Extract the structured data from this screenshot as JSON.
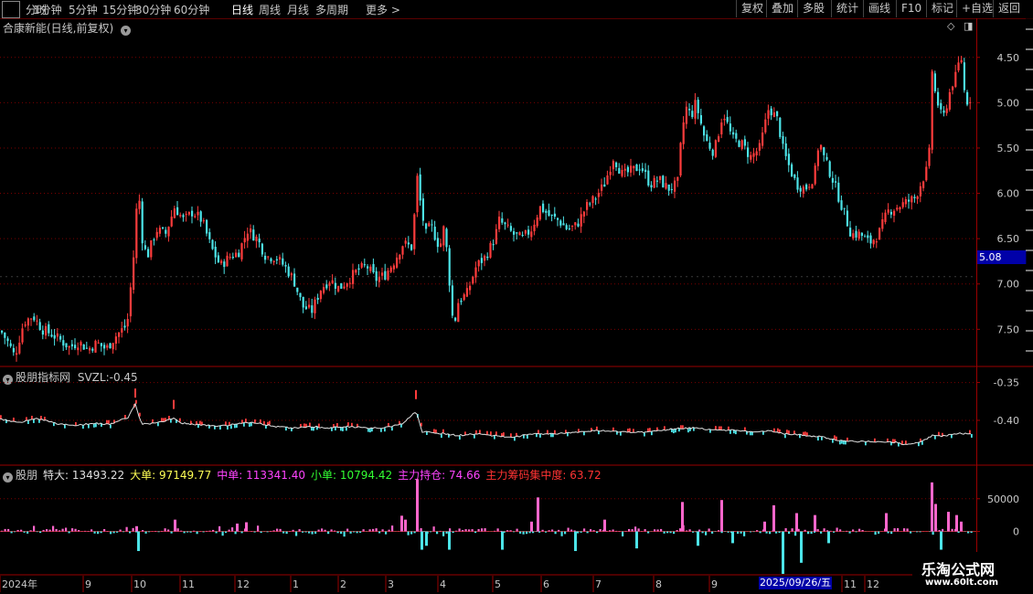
{
  "toolbar": {
    "timeframes": [
      "分时",
      "1分钟",
      "5分钟",
      "15分钟",
      "30分钟",
      "60分钟",
      "日线",
      "周线",
      "月线",
      "多周期",
      "更多 >"
    ],
    "active": "日线",
    "buttons": [
      "复权",
      "叠加",
      "多股",
      "统计",
      "画线",
      "F10",
      "标记",
      "+自选",
      "返回"
    ]
  },
  "main": {
    "title": "合康新能(日线,前复权)",
    "price_tag": "5.08",
    "right_labels": [
      "7.50",
      "7.00",
      "6.50",
      "6.00",
      "5.50",
      "5.00",
      "4.50"
    ]
  },
  "indicator1": {
    "title": "股朋指标网",
    "name": "SVZL:",
    "value": "-0.45",
    "right_labels": [
      "-0.35",
      "-0.40"
    ]
  },
  "indicator2": {
    "title": "股朋",
    "items": [
      {
        "label": "特大:",
        "value": "13493.22",
        "color": "#e0e0e0"
      },
      {
        "label": "大单:",
        "value": "97149.77",
        "color": "#ffff55"
      },
      {
        "label": "中单:",
        "value": "113341.40",
        "color": "#ff44ff"
      },
      {
        "label": "小单:",
        "value": "10794.42",
        "color": "#33ff33"
      },
      {
        "label": "主力持仓:",
        "value": "74.66",
        "color": "#ff44ff"
      },
      {
        "label": "主力筹码集中度:",
        "value": "63.72",
        "color": "#ff3333"
      }
    ],
    "right_labels": [
      "50000",
      "0"
    ]
  },
  "xaxis": {
    "labels": [
      "2024年",
      "9",
      "10",
      "11",
      "12",
      "1",
      "2",
      "3",
      "4",
      "5",
      "6",
      "7",
      "8",
      "9",
      "10",
      "11",
      "12"
    ],
    "highlight": "2025/09/26/五"
  },
  "watermark": {
    "line1": "乐淘公式网",
    "line2": "www.60lt.com"
  },
  "colors": {
    "up": "#ff3c3c",
    "down": "#4ce4e8",
    "grid": "#7a0000",
    "pink": "#ff66cc"
  },
  "chart_data": [
    {
      "type": "candlestick",
      "title": "合康新能(日线,前复权)",
      "ylim": [
        4.1,
        7.75
      ],
      "y_ticks": [
        4.5,
        5.0,
        5.5,
        6.0,
        6.5,
        7.0,
        7.5
      ],
      "current_price": 5.08,
      "close_path": [
        [
          0,
          4.48
        ],
        [
          8,
          4.35
        ],
        [
          15,
          4.2
        ],
        [
          25,
          4.58
        ],
        [
          35,
          4.65
        ],
        [
          45,
          4.5
        ],
        [
          55,
          4.45
        ],
        [
          65,
          4.38
        ],
        [
          75,
          4.3
        ],
        [
          85,
          4.36
        ],
        [
          95,
          4.28
        ],
        [
          105,
          4.35
        ],
        [
          115,
          4.28
        ],
        [
          125,
          4.42
        ],
        [
          138,
          4.55
        ],
        [
          145,
          5.3
        ],
        [
          150,
          6.1
        ],
        [
          155,
          5.45
        ],
        [
          160,
          5.3
        ],
        [
          170,
          5.6
        ],
        [
          180,
          5.55
        ],
        [
          190,
          5.85
        ],
        [
          200,
          5.7
        ],
        [
          210,
          5.8
        ],
        [
          220,
          5.7
        ],
        [
          230,
          5.4
        ],
        [
          240,
          5.2
        ],
        [
          250,
          5.3
        ],
        [
          260,
          5.35
        ],
        [
          270,
          5.6
        ],
        [
          280,
          5.5
        ],
        [
          290,
          5.3
        ],
        [
          300,
          5.3
        ],
        [
          310,
          5.2
        ],
        [
          320,
          5.05
        ],
        [
          330,
          4.75
        ],
        [
          340,
          4.7
        ],
        [
          350,
          4.95
        ],
        [
          360,
          5.05
        ],
        [
          370,
          4.95
        ],
        [
          380,
          5.05
        ],
        [
          390,
          5.15
        ],
        [
          400,
          5.2
        ],
        [
          410,
          5.05
        ],
        [
          420,
          5.1
        ],
        [
          430,
          5.25
        ],
        [
          440,
          5.45
        ],
        [
          450,
          5.4
        ],
        [
          455,
          6.2
        ],
        [
          460,
          5.8
        ],
        [
          465,
          5.55
        ],
        [
          470,
          5.65
        ],
        [
          480,
          5.4
        ],
        [
          485,
          5.65
        ],
        [
          490,
          5.1
        ],
        [
          495,
          4.5
        ],
        [
          500,
          4.8
        ],
        [
          510,
          4.9
        ],
        [
          520,
          5.2
        ],
        [
          530,
          5.3
        ],
        [
          540,
          5.5
        ],
        [
          545,
          5.7
        ],
        [
          550,
          5.65
        ],
        [
          560,
          5.55
        ],
        [
          570,
          5.5
        ],
        [
          580,
          5.6
        ],
        [
          590,
          5.85
        ],
        [
          600,
          5.75
        ],
        [
          610,
          5.7
        ],
        [
          620,
          5.6
        ],
        [
          630,
          5.65
        ],
        [
          640,
          5.85
        ],
        [
          650,
          5.95
        ],
        [
          660,
          6.1
        ],
        [
          670,
          6.4
        ],
        [
          680,
          6.2
        ],
        [
          690,
          6.25
        ],
        [
          700,
          6.3
        ],
        [
          710,
          6.1
        ],
        [
          720,
          6.15
        ],
        [
          730,
          6.05
        ],
        [
          740,
          6.1
        ],
        [
          745,
          6.7
        ],
        [
          750,
          6.95
        ],
        [
          755,
          6.85
        ],
        [
          760,
          7.0
        ],
        [
          765,
          6.8
        ],
        [
          770,
          6.6
        ],
        [
          780,
          6.45
        ],
        [
          790,
          6.9
        ],
        [
          800,
          6.6
        ],
        [
          810,
          6.55
        ],
        [
          820,
          6.4
        ],
        [
          830,
          6.5
        ],
        [
          840,
          6.95
        ],
        [
          850,
          6.8
        ],
        [
          855,
          6.5
        ],
        [
          860,
          6.35
        ],
        [
          870,
          6.1
        ],
        [
          880,
          6.05
        ],
        [
          890,
          6.2
        ],
        [
          895,
          6.6
        ],
        [
          900,
          6.4
        ],
        [
          910,
          6.15
        ],
        [
          920,
          5.85
        ],
        [
          930,
          5.55
        ],
        [
          940,
          5.55
        ],
        [
          950,
          5.45
        ],
        [
          960,
          5.55
        ],
        [
          970,
          5.8
        ],
        [
          980,
          5.85
        ],
        [
          990,
          5.9
        ],
        [
          1000,
          5.95
        ],
        [
          1010,
          6.2
        ],
        [
          1015,
          6.3
        ],
        [
          1018,
          7.4
        ],
        [
          1022,
          7.1
        ],
        [
          1030,
          6.8
        ],
        [
          1040,
          7.2
        ],
        [
          1045,
          7.3
        ],
        [
          1050,
          7.55
        ],
        [
          1055,
          7.0
        ],
        [
          1060,
          7.05
        ]
      ]
    },
    {
      "type": "line",
      "title": "股朋指标网",
      "series": [
        {
          "name": "SVZL",
          "last": -0.45
        }
      ],
      "y_ticks": [
        -0.35,
        -0.4
      ],
      "ylim": [
        -0.458,
        -0.33
      ],
      "path": [
        [
          0,
          -0.398
        ],
        [
          20,
          -0.403
        ],
        [
          40,
          -0.397
        ],
        [
          60,
          -0.404
        ],
        [
          80,
          -0.407
        ],
        [
          100,
          -0.404
        ],
        [
          120,
          -0.405
        ],
        [
          140,
          -0.396
        ],
        [
          148,
          -0.379
        ],
        [
          155,
          -0.405
        ],
        [
          170,
          -0.404
        ],
        [
          190,
          -0.398
        ],
        [
          200,
          -0.404
        ],
        [
          220,
          -0.406
        ],
        [
          240,
          -0.408
        ],
        [
          260,
          -0.404
        ],
        [
          280,
          -0.403
        ],
        [
          300,
          -0.408
        ],
        [
          320,
          -0.41
        ],
        [
          340,
          -0.408
        ],
        [
          360,
          -0.41
        ],
        [
          380,
          -0.408
        ],
        [
          400,
          -0.41
        ],
        [
          420,
          -0.41
        ],
        [
          440,
          -0.405
        ],
        [
          455,
          -0.388
        ],
        [
          462,
          -0.415
        ],
        [
          480,
          -0.417
        ],
        [
          500,
          -0.42
        ],
        [
          520,
          -0.418
        ],
        [
          540,
          -0.42
        ],
        [
          560,
          -0.423
        ],
        [
          580,
          -0.418
        ],
        [
          600,
          -0.418
        ],
        [
          620,
          -0.417
        ],
        [
          640,
          -0.414
        ],
        [
          660,
          -0.414
        ],
        [
          680,
          -0.415
        ],
        [
          700,
          -0.416
        ],
        [
          720,
          -0.414
        ],
        [
          740,
          -0.411
        ],
        [
          760,
          -0.41
        ],
        [
          780,
          -0.413
        ],
        [
          800,
          -0.413
        ],
        [
          820,
          -0.415
        ],
        [
          840,
          -0.414
        ],
        [
          860,
          -0.418
        ],
        [
          880,
          -0.42
        ],
        [
          900,
          -0.422
        ],
        [
          920,
          -0.427
        ],
        [
          940,
          -0.428
        ],
        [
          960,
          -0.428
        ],
        [
          980,
          -0.429
        ],
        [
          990,
          -0.432
        ],
        [
          1000,
          -0.43
        ],
        [
          1010,
          -0.427
        ],
        [
          1020,
          -0.42
        ],
        [
          1030,
          -0.421
        ],
        [
          1040,
          -0.419
        ],
        [
          1050,
          -0.417
        ],
        [
          1060,
          -0.418
        ]
      ]
    },
    {
      "type": "bar",
      "title": "股朋",
      "y_ticks": [
        0,
        50000
      ],
      "ylim": [
        -65000,
        100000
      ],
      "spikes": [
        [
          148,
          8000
        ],
        [
          150,
          -30000
        ],
        [
          190,
          18000
        ],
        [
          258,
          12000
        ],
        [
          268,
          14000
        ],
        [
          438,
          24000
        ],
        [
          442,
          18000
        ],
        [
          455,
          80000
        ],
        [
          460,
          -28000
        ],
        [
          465,
          -22000
        ],
        [
          490,
          -28000
        ],
        [
          548,
          -28000
        ],
        [
          580,
          15000
        ],
        [
          587,
          52000
        ],
        [
          628,
          -30000
        ],
        [
          660,
          18000
        ],
        [
          695,
          -26000
        ],
        [
          745,
          45000
        ],
        [
          762,
          -22000
        ],
        [
          788,
          48000
        ],
        [
          800,
          -18000
        ],
        [
          835,
          15000
        ],
        [
          845,
          40000
        ],
        [
          855,
          -65000
        ],
        [
          870,
          28000
        ],
        [
          875,
          -48000
        ],
        [
          890,
          25000
        ],
        [
          905,
          -18000
        ],
        [
          968,
          28000
        ],
        [
          1018,
          75000
        ],
        [
          1022,
          42000
        ],
        [
          1028,
          -28000
        ],
        [
          1036,
          30000
        ],
        [
          1045,
          25000
        ],
        [
          1050,
          15000
        ]
      ]
    }
  ]
}
